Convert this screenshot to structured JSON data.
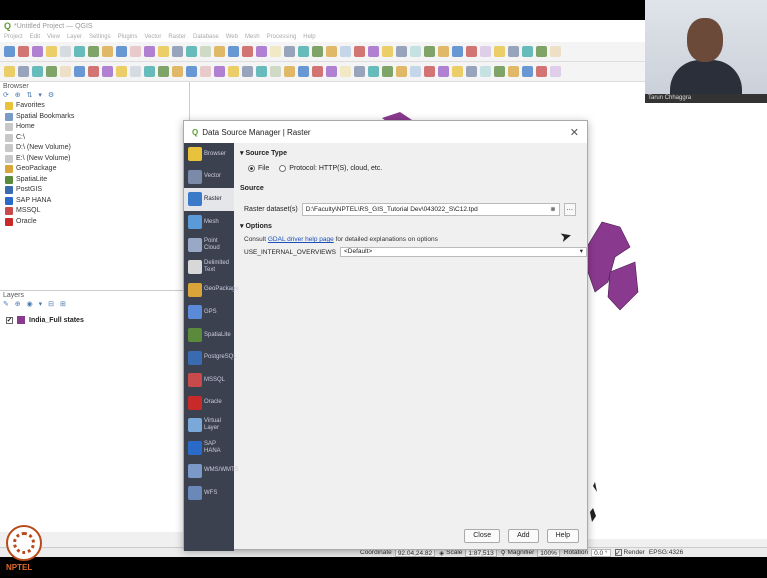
{
  "window": {
    "title": "*Untitled Project — QGIS"
  },
  "menu": [
    "Project",
    "Edit",
    "View",
    "Layer",
    "Settings",
    "Plugins",
    "Vector",
    "Raster",
    "Database",
    "Web",
    "Mesh",
    "Processing",
    "Help"
  ],
  "browser": {
    "title": "Browser",
    "items": [
      {
        "label": "Favorites",
        "color": "#e8c23a"
      },
      {
        "label": "Spatial Bookmarks",
        "color": "#7a9ac8"
      },
      {
        "label": "Home",
        "color": "#c8c8c8"
      },
      {
        "label": "C:\\",
        "color": "#c8c8c8"
      },
      {
        "label": "D:\\ (New Volume)",
        "color": "#c8c8c8"
      },
      {
        "label": "E:\\ (New Volume)",
        "color": "#c8c8c8"
      },
      {
        "label": "GeoPackage",
        "color": "#d9a53a"
      },
      {
        "label": "SpatiaLite",
        "color": "#5a8a3a"
      },
      {
        "label": "PostGIS",
        "color": "#3a6ab0"
      },
      {
        "label": "SAP HANA",
        "color": "#2a6ac8"
      },
      {
        "label": "MSSQL",
        "color": "#c84a4a"
      },
      {
        "label": "Oracle",
        "color": "#c82a2a"
      }
    ]
  },
  "layers": {
    "title": "Layers",
    "items": [
      {
        "label": "India_Full states",
        "checked": "✓",
        "color": "#8a3a8e"
      }
    ]
  },
  "dialog": {
    "title": "Data Source Manager | Raster",
    "sidebar": [
      {
        "label": "Browser",
        "color": "#e8c23a"
      },
      {
        "label": "Vector",
        "color": "#7a8aa8"
      },
      {
        "label": "Raster",
        "color": "#3a7ac8"
      },
      {
        "label": "Mesh",
        "color": "#5a9ad8"
      },
      {
        "label": "Point Cloud",
        "color": "#9aa8c8"
      },
      {
        "label": "Delimited Text",
        "color": "#d8d8d8"
      },
      {
        "label": "GeoPackage",
        "color": "#d9a53a"
      },
      {
        "label": "GPS",
        "color": "#5a8ad8"
      },
      {
        "label": "SpatiaLite",
        "color": "#5a8a3a"
      },
      {
        "label": "PostgreSQL",
        "color": "#3a6ab0"
      },
      {
        "label": "MSSQL",
        "color": "#c84a4a"
      },
      {
        "label": "Oracle",
        "color": "#c82a2a"
      },
      {
        "label": "Virtual Layer",
        "color": "#7aa8d8"
      },
      {
        "label": "SAP HANA",
        "color": "#2a6ac8"
      },
      {
        "label": "WMS/WMTS",
        "color": "#7a98c8"
      },
      {
        "label": "WFS",
        "color": "#6a88b8"
      }
    ],
    "active_index": 2,
    "source_type": {
      "heading": "Source Type",
      "options": [
        "File",
        "Protocol: HTTP(S), cloud, etc."
      ],
      "selected": 0
    },
    "source": {
      "heading": "Source",
      "label": "Raster dataset(s)",
      "value": "D:\\Faculty\\NPTEL\\RS_GIS_Tutorial Dev\\043022_S\\C12.tpd"
    },
    "options": {
      "heading": "Options",
      "consult_prefix": "Consult",
      "consult_link": "GDAL driver help page",
      "consult_suffix": "for detailed explanations on options",
      "overviews_label": "USE_INTERNAL_OVERVIEWS",
      "overviews_value": "<Default>"
    },
    "buttons": {
      "close": "Close",
      "add": "Add",
      "help": "Help"
    }
  },
  "status": {
    "coordinate_label": "Coordinate",
    "coordinate_value": "92.04,24.82",
    "scale_label": "Scale",
    "scale_value": "1:87,513",
    "magnifier_label": "Magnifier",
    "magnifier_value": "100%",
    "rotation_label": "Rotation",
    "rotation_value": "0.0 °",
    "render_label": "Render",
    "crs_value": "EPSG:4326"
  },
  "webcam": {
    "name": "Tarun Chhaggra"
  },
  "logo": {
    "text": "NPTEL"
  },
  "colors": {
    "accent": "#5a9e2e",
    "layer_fill": "#8a3a8e",
    "dialog_sidebar": "#3c4150"
  }
}
